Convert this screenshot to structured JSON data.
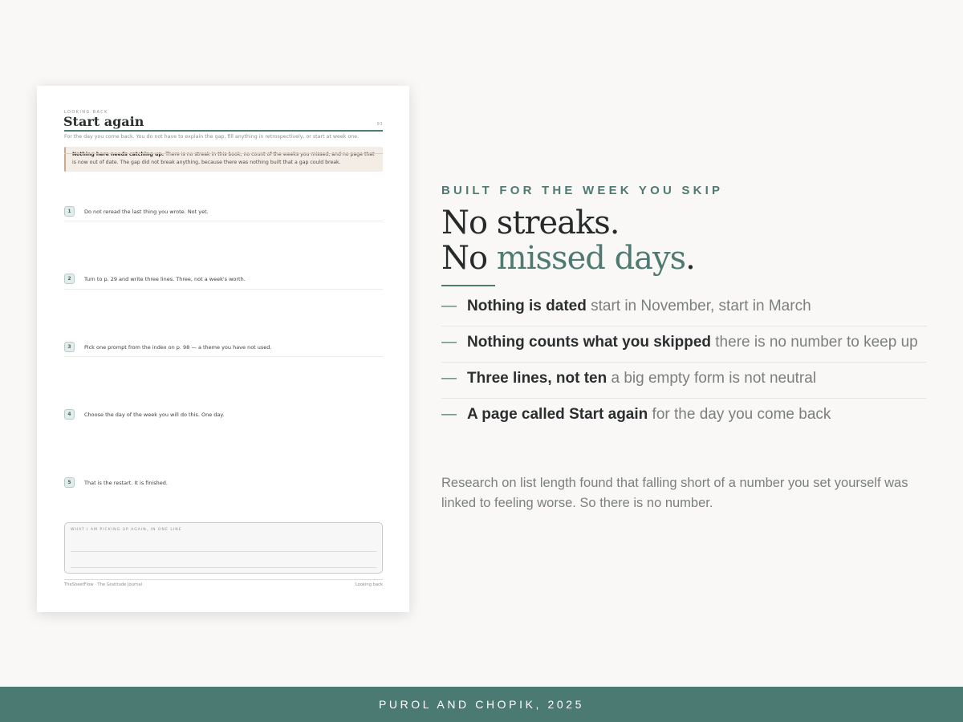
{
  "sheet": {
    "eyebrow": "LOOKING BACK",
    "title": "Start again",
    "page_number": "93",
    "intro": "For the day you come back. You do not have to explain the gap, fill anything in retrospectively, or start at week one.",
    "callout_bold": "Nothing here needs catching up.",
    "callout_text": " There is no streak in this book, no count of the weeks you missed, and no page that is now out of date. The gap did not break anything, because there was nothing built that a gap could break.",
    "steps": [
      {
        "num": "1",
        "text": "Do not reread the last thing you wrote. Not yet."
      },
      {
        "num": "2",
        "text": "Turn to p. 29 and write three lines. Three, not a week's worth."
      },
      {
        "num": "3",
        "text": "Pick one prompt from the index on p. 98 — a theme you have not used."
      },
      {
        "num": "4",
        "text": "Choose the day of the week you will do this. One day."
      },
      {
        "num": "5",
        "text": "That is the restart. It is finished."
      }
    ],
    "box_label": "WHAT I AM PICKING UP AGAIN, IN ONE LINE",
    "footer_left": "TheSheetFlow · The Gratitude Journal",
    "footer_right": "Looking back"
  },
  "copy": {
    "eyebrow": "BUILT FOR THE WEEK YOU SKIP",
    "headline_line1": "No streaks.",
    "headline_line2_start": "No ",
    "headline_line2_accent": "missed days",
    "headline_line2_end": ".",
    "bullets": [
      {
        "strong": "Nothing is dated",
        "rest": " start in November, start in March"
      },
      {
        "strong": "Nothing counts what you skipped",
        "rest": " there is no number to keep up"
      },
      {
        "strong": "Three lines, not ten",
        "rest": " a big empty form is not neutral"
      },
      {
        "strong": "A page called Start again",
        "rest": " for the day you come back"
      }
    ],
    "dash": "—",
    "note": "Research on list length found that falling short of a number you set yourself was linked to feeling worse. So there is no number."
  },
  "footer": {
    "citation": "PUROL AND CHOPIK, 2025"
  },
  "colors": {
    "accent": "#4e7a72",
    "footer_bg": "#4b7a72",
    "background": "#f9f8f6"
  }
}
